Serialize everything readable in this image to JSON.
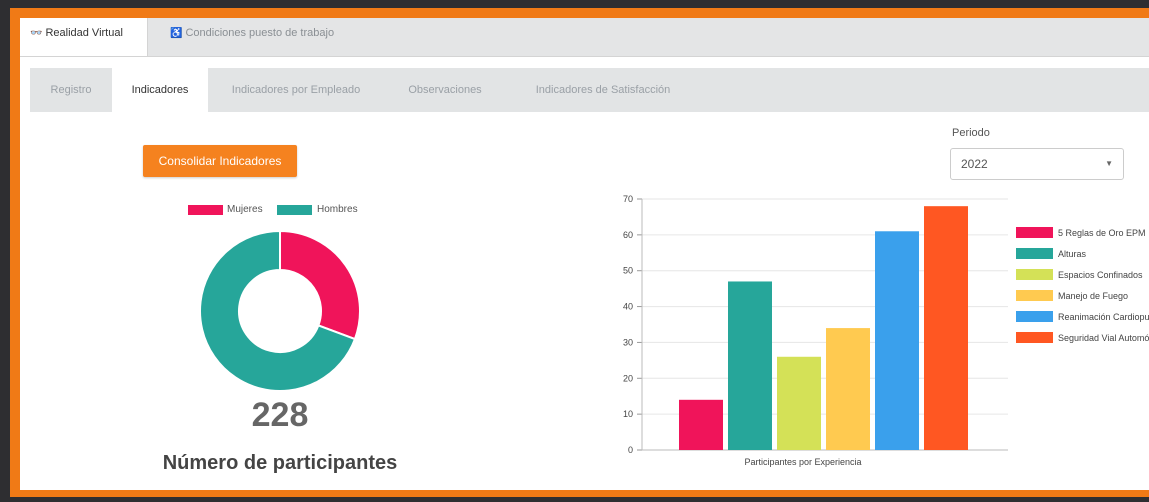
{
  "top_tabs": [
    {
      "icon": "vr-headset-icon",
      "label": "Realidad Virtual"
    },
    {
      "icon": "ergonomics-icon",
      "label": "Condiciones puesto de trabajo"
    }
  ],
  "sub_tabs": [
    {
      "label": "Registro"
    },
    {
      "label": "Indicadores"
    },
    {
      "label": "Indicadores por Empleado"
    },
    {
      "label": "Observaciones"
    },
    {
      "label": "Indicadores de Satisfacción"
    }
  ],
  "active_sub_tab": "Indicadores",
  "button": {
    "label": "Consolidar Indicadores"
  },
  "period": {
    "label": "Periodo",
    "value": "2022"
  },
  "participants": {
    "count": "228",
    "label": "Número de participantes"
  },
  "colors": {
    "accent": "#f5821f",
    "frame": "#f07a16"
  },
  "chart_data": [
    {
      "type": "pie",
      "variant": "donut",
      "labels": [
        "Mujeres",
        "Hombres"
      ],
      "values": [
        70,
        158
      ],
      "colors": [
        "#f0145a",
        "#26a69a"
      ],
      "legend": "top"
    },
    {
      "type": "bar",
      "xlabel": "Participantes por Experiencia",
      "ylim": [
        0,
        70
      ],
      "yticks": [
        0,
        10,
        20,
        30,
        40,
        50,
        60,
        70
      ],
      "grid": true,
      "legend": "right",
      "series": [
        {
          "name": "5 Reglas de Oro EPM",
          "value": 14,
          "color": "#f0145a"
        },
        {
          "name": "Alturas",
          "value": 47,
          "color": "#26a69a"
        },
        {
          "name": "Espacios Confinados",
          "value": 26,
          "color": "#d4e157"
        },
        {
          "name": "Manejo de Fuego",
          "value": 34,
          "color": "#ffca50"
        },
        {
          "name": "Reanimación Cardiopu",
          "value": 61,
          "color": "#3aa0ec"
        },
        {
          "name": "Seguridad Vial Automó",
          "value": 68,
          "color": "#ff5722"
        }
      ]
    }
  ]
}
